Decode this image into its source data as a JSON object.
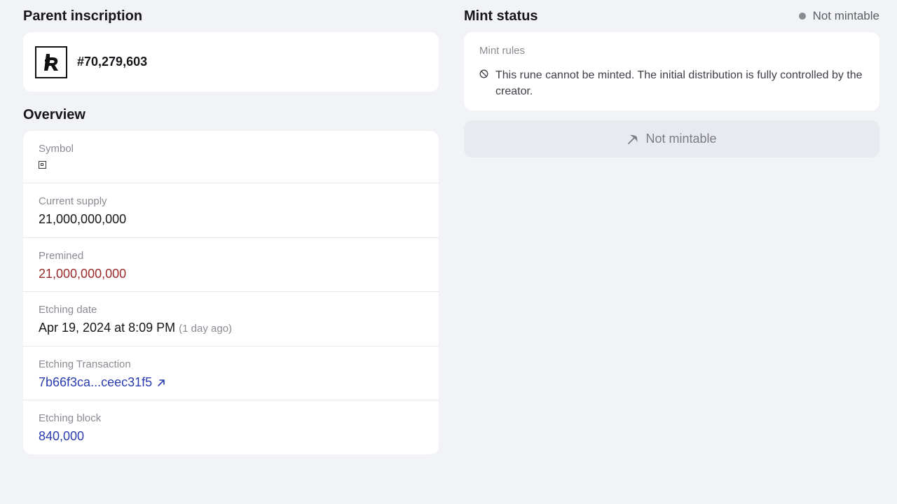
{
  "parent_inscription": {
    "title": "Parent inscription",
    "number": "#70,279,603"
  },
  "overview": {
    "title": "Overview",
    "rows": [
      {
        "label": "Symbol",
        "value": ""
      },
      {
        "label": "Current supply",
        "value": "21,000,000,000"
      },
      {
        "label": "Premined",
        "value": "21,000,000,000"
      },
      {
        "label": "Etching date",
        "value": "Apr 19, 2024 at 8:09 PM",
        "note": "(1 day ago)"
      },
      {
        "label": "Etching Transaction",
        "value": "7b66f3ca...ceec31f5"
      },
      {
        "label": "Etching block",
        "value": "840,000"
      }
    ]
  },
  "mint_status": {
    "title": "Mint status",
    "status_label": "Not mintable",
    "rules_label": "Mint rules",
    "rules_text": "This rune cannot be minted. The initial distribution is fully controlled by the creator.",
    "button_label": "Not mintable"
  },
  "colors": {
    "background": "#f2f3f7",
    "card": "#ffffff",
    "premined_red": "#9a2a2a",
    "link_blue": "#2b3bb0",
    "muted": "#8a8b93"
  },
  "icons": {
    "inscription": "bitcoin-rune-logo-icon",
    "symbol": "square-symbol-icon",
    "external": "external-link-arrow-icon",
    "no_mint": "prohibited-icon",
    "pickaxe": "pickaxe-icon"
  }
}
